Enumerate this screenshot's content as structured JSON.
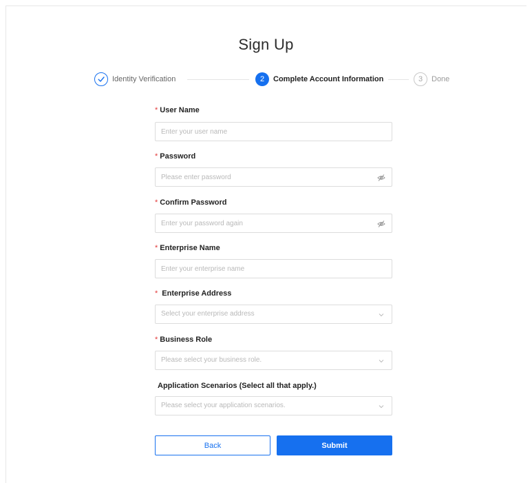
{
  "page": {
    "title": "Sign Up"
  },
  "steps": [
    {
      "number": "1",
      "label": "Identity Verification",
      "status": "done"
    },
    {
      "number": "2",
      "label": "Complete Account Information",
      "status": "active"
    },
    {
      "number": "3",
      "label": "Done",
      "status": "pending"
    }
  ],
  "form": {
    "user_name": {
      "label": "User Name",
      "required": "*",
      "placeholder": "Enter your user name"
    },
    "password": {
      "label": "Password",
      "required": "*",
      "placeholder": "Please enter password",
      "icon": "eye-off-icon"
    },
    "confirm_password": {
      "label": "Confirm Password",
      "required": "*",
      "placeholder": "Enter your password again",
      "icon": "eye-off-icon"
    },
    "enterprise_name": {
      "label": "Enterprise Name",
      "required": "*",
      "placeholder": "Enter your enterprise name"
    },
    "enterprise_address": {
      "label": "Enterprise Address",
      "required": "*",
      "placeholder": "Select your enterprise address",
      "icon": "chevron-down-icon"
    },
    "business_role": {
      "label": "Business Role",
      "required": "*",
      "placeholder": "Please select your business role.",
      "icon": "chevron-down-icon"
    },
    "application_scenarios": {
      "label": "Application Scenarios (Select all that apply.)",
      "placeholder": "Please select your application scenarios.",
      "icon": "chevron-down-icon"
    }
  },
  "buttons": {
    "back": "Back",
    "submit": "Submit"
  },
  "colors": {
    "primary": "#1670ef",
    "required": "#e23a3a",
    "border": "#dcdcdc"
  }
}
